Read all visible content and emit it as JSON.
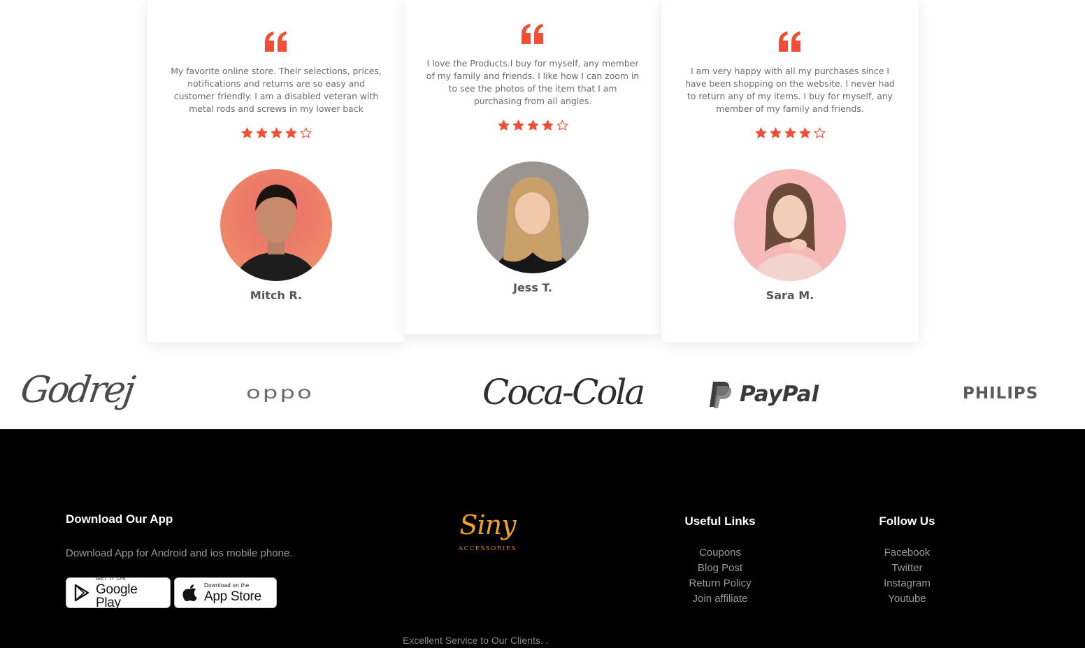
{
  "testimonials": [
    {
      "text": "My favorite online store. Their selections, prices, notifications and returns are so easy and customer friendly. I am a disabled veteran with metal rods and screws in my lower back",
      "rating": 4,
      "rating_max": 5,
      "name": "Mitch R."
    },
    {
      "text": "I love the Products.I buy for myself, any member of my family and friends. I like how I can zoom in to see the photos of the item that I am purchasing from all angles.",
      "rating": 4,
      "rating_max": 5,
      "name": "Jess T."
    },
    {
      "text": "I am very happy with all my purchases since I have been shopping on the website. I never had to return any of my items. I buy for myself, any member of my family and friends.",
      "rating": 4,
      "rating_max": 5,
      "name": "Sara M."
    }
  ],
  "brands": {
    "godrej": "Godrej",
    "oppo": "oppo",
    "cocacola": "Coca-Cola",
    "paypal": "PayPal",
    "philips": "PHILIPS"
  },
  "footer": {
    "app": {
      "heading": "Download Our App",
      "description": "Download App for Android and ios mobile phone.",
      "google_play": {
        "small": "GET IT ON",
        "big": "Google Play"
      },
      "app_store": {
        "small": "Download on the",
        "big": "App Store"
      }
    },
    "logo": {
      "name": "Siny",
      "sub": "ACCESSORIES"
    },
    "useful_links": {
      "heading": "Useful Links",
      "items": [
        "Coupons",
        "Blog Post",
        "Return Policy",
        "Join affiliate"
      ]
    },
    "follow_us": {
      "heading": "Follow Us",
      "items": [
        "Facebook",
        "Twitter",
        "Instagram",
        "Youtube"
      ]
    },
    "tagline": "Excellent Service to Our Clients. ."
  },
  "colors": {
    "accent": "#f04e37",
    "footer_bg": "#000000",
    "logo": "#f2a12b"
  },
  "icons": {
    "quote": "quote-icon",
    "star_filled": "star-filled-icon",
    "star_empty": "star-outline-icon",
    "google_play": "google-play-icon",
    "apple": "apple-icon"
  }
}
